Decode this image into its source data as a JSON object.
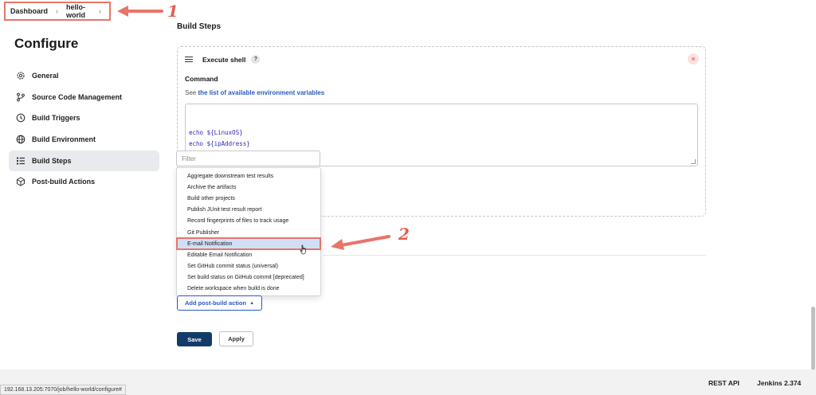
{
  "breadcrumb": {
    "items": [
      "Dashboard",
      "hello-world"
    ]
  },
  "annotations": {
    "one": "1",
    "two": "2",
    "color": "#e35d4f"
  },
  "page_title": "Configure",
  "sidebar": {
    "items": [
      {
        "label": "General",
        "icon": "gear-icon"
      },
      {
        "label": "Source Code Management",
        "icon": "branch-icon"
      },
      {
        "label": "Build Triggers",
        "icon": "clock-icon"
      },
      {
        "label": "Build Environment",
        "icon": "globe-icon"
      },
      {
        "label": "Build Steps",
        "icon": "list-icon",
        "active": true
      },
      {
        "label": "Post-build Actions",
        "icon": "cube-icon"
      }
    ]
  },
  "build_steps": {
    "title": "Build Steps",
    "step": {
      "name": "Execute shell",
      "help": "?",
      "close": "×",
      "command_label": "Command",
      "see_prefix": "See",
      "env_link": "the list of available environment variables",
      "command_lines": [
        "echo ${LinuxOS}",
        "echo ${ipAddress}"
      ]
    }
  },
  "dropdown": {
    "filter_placeholder": "Filter",
    "items": [
      "Aggregate downstream test results",
      "Archive the artifacts",
      "Build other projects",
      "Publish JUnit test result report",
      "Record fingerprints of files to track usage",
      "Git Publisher",
      "E-mail Notification",
      "Editable Email Notification",
      "Set GitHub commit status (universal)",
      "Set build status on GitHub commit [deprecated]",
      "Delete workspace when build is done"
    ],
    "highlighted_index": 6
  },
  "buttons": {
    "add_post_build": "Add post-build action",
    "save": "Save",
    "apply": "Apply"
  },
  "footer": {
    "rest_api": "REST API",
    "version": "Jenkins 2.374",
    "status_url": "192.168.13.205:7070/job/hello-world/configure#"
  },
  "colors": {
    "accent": "#2b58c4",
    "save_bg": "#123b69",
    "highlight": "#cfe0f6",
    "annotation": "#e8746a"
  }
}
